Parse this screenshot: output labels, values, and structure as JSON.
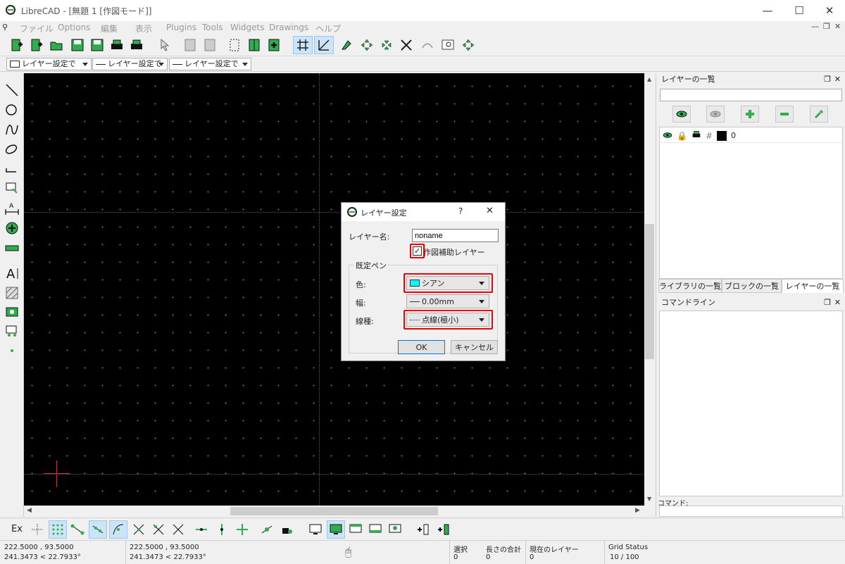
{
  "window": {
    "title": "LibreCAD - [無題 1 [作図モード]]"
  },
  "menu": [
    "ファイル",
    "Options",
    "編集",
    "表示",
    "Plugins",
    "Tools",
    "Widgets",
    "Drawings",
    "ヘルプ"
  ],
  "toolbar2": {
    "layer_combo": "レイヤー設定で",
    "width_combo": "レイヤー設定で",
    "linetype_combo": "レイヤー設定で"
  },
  "layer_panel": {
    "title": "レイヤーの一覧",
    "search_value": "",
    "layer_name": "0"
  },
  "tabs": [
    "ライブラリの一覧",
    "ブロックの一覧",
    "レイヤーの一覧"
  ],
  "command_panel": {
    "title": "コマンドライン",
    "prompt_label": "コマンド:"
  },
  "dialog": {
    "title": "レイヤー設定",
    "help": "?",
    "name_label": "レイヤー名:",
    "name_value": "noname",
    "helper_label": "作図補助レイヤー",
    "helper_checked": true,
    "pen_group": "既定ペン",
    "color_label": "色:",
    "color_value": "シアン",
    "color_swatch": "#00ffff",
    "width_label": "幅:",
    "width_value": "0.00mm",
    "linetype_label": "線種:",
    "linetype_value": "点線(極小)",
    "ok": "OK",
    "cancel": "キャンセル"
  },
  "bottom": {
    "ex_label": "Ex"
  },
  "status": {
    "coord1_a": "222.5000 , 93.5000",
    "coord1_b": "241.3473 < 22.7933°",
    "coord2_a": "222.5000 , 93.5000",
    "coord2_b": "241.3473 < 22.7933°",
    "select_label": "選択",
    "select_value": "0",
    "length_label": "長さの合計",
    "length_value": "0",
    "layer_label": "現在のレイヤー",
    "layer_value": "0",
    "grid_label": "Grid Status",
    "grid_value": "10 / 100"
  },
  "colors": {
    "accent": "#2fae4e",
    "highlight": "#e00000",
    "canvas": "#000000"
  }
}
